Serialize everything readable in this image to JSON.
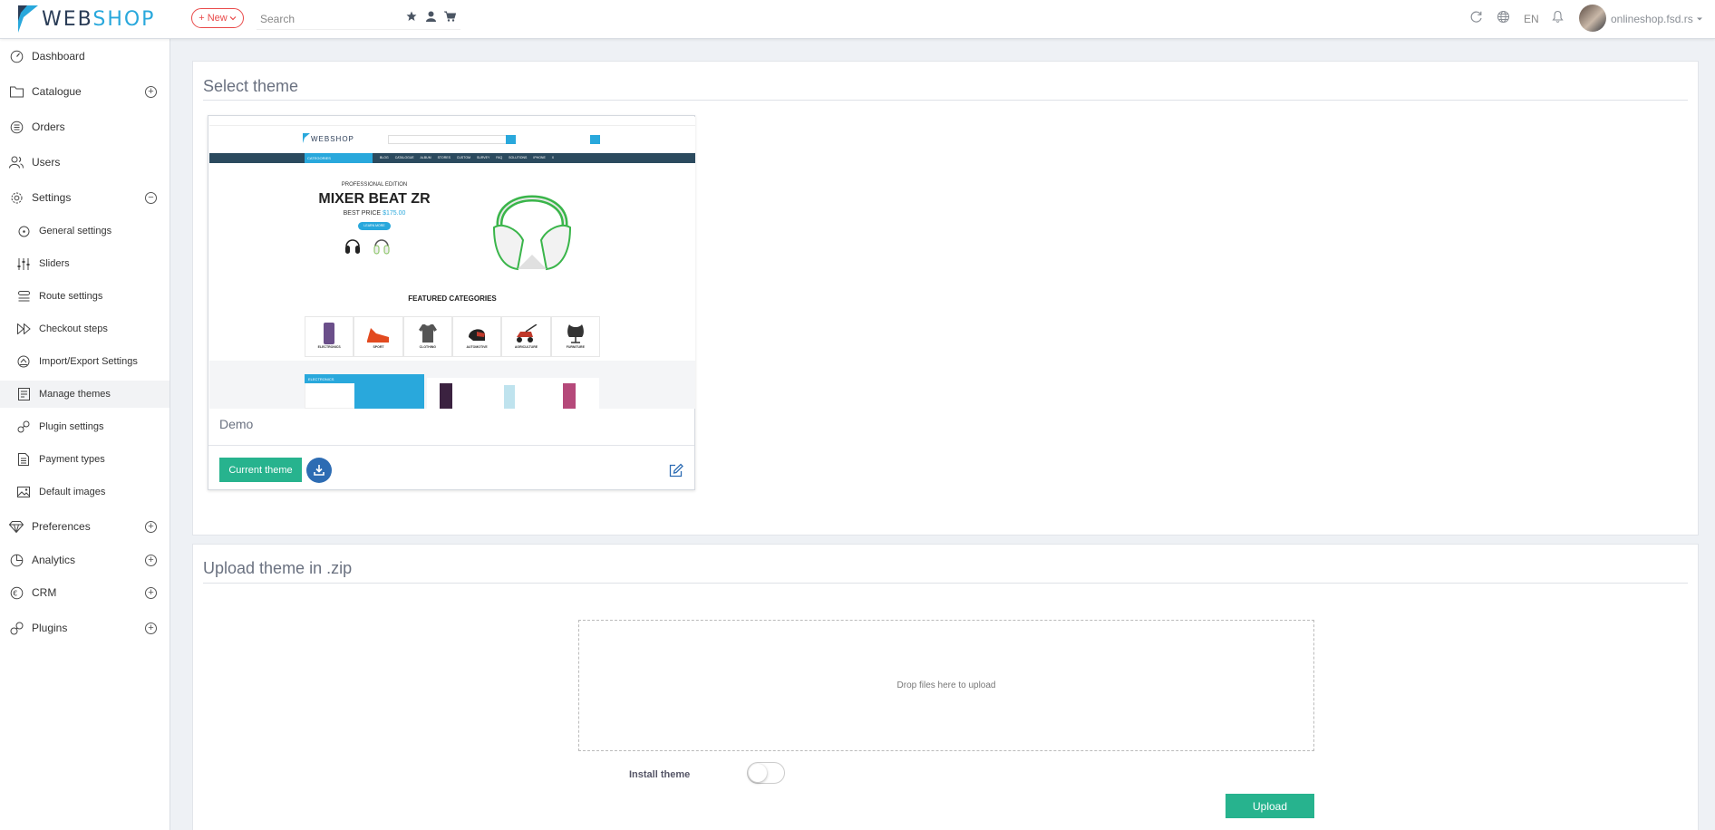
{
  "header": {
    "logo_left": "WEB",
    "logo_right": "SHOP",
    "new_label": "+ New",
    "search_placeholder": "Search",
    "language": "EN",
    "user": "onlineshop.fsd.rs"
  },
  "sidebar": {
    "items": [
      {
        "label": "Dashboard"
      },
      {
        "label": "Catalogue"
      },
      {
        "label": "Orders"
      },
      {
        "label": "Users"
      },
      {
        "label": "Settings"
      },
      {
        "label": "Preferences"
      },
      {
        "label": "Analytics"
      },
      {
        "label": "CRM"
      },
      {
        "label": "Plugins"
      }
    ],
    "settings_sub": [
      {
        "label": "General settings"
      },
      {
        "label": "Sliders"
      },
      {
        "label": "Route settings"
      },
      {
        "label": "Checkout steps"
      },
      {
        "label": "Import/Export Settings"
      },
      {
        "label": "Manage themes"
      },
      {
        "label": "Plugin settings"
      },
      {
        "label": "Payment types"
      },
      {
        "label": "Default images"
      }
    ]
  },
  "select_theme": {
    "title": "Select theme",
    "theme": {
      "name": "Demo",
      "current_label": "Current theme"
    },
    "preview": {
      "logo": "WEBSHOP",
      "edition": "PROFESSIONAL EDITION",
      "headline": "MIXER BEAT ZR",
      "best_price": "BEST PRICE",
      "price": "$175.00",
      "learn_more": "LEARN MORE",
      "categories_btn": "CATEGORIES",
      "nav_items": "BLOG CATALOGUE ALBUM STORES CUSTOM SURVEY FAQ SOLUTIONS IPHONE X",
      "featured": "FEATURED CATEGORIES",
      "categories": [
        "ELECTRONICS",
        "SPORT",
        "CLOTHING",
        "AUTOMOTIVE",
        "AGRICULTURE",
        "FURNITURE"
      ],
      "electronics_banner": "ELECTRONICS"
    }
  },
  "upload_theme": {
    "title": "Upload theme in .zip",
    "drop_text": "Drop files here to upload",
    "install_label": "Install theme",
    "install_enabled": false,
    "upload_label": "Upload"
  }
}
